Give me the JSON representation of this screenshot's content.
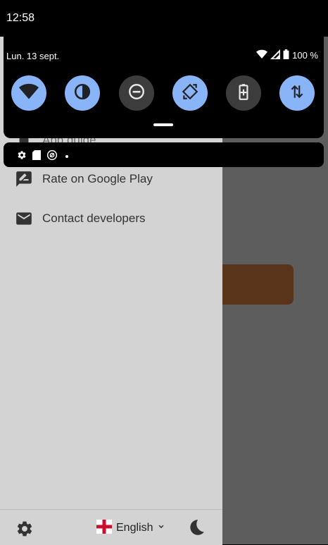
{
  "status_bar": {
    "time": "12:58"
  },
  "quick_settings": {
    "date": "Lun. 13 sept.",
    "battery_pct": "100 %",
    "tiles": [
      {
        "name": "wifi",
        "state": "on"
      },
      {
        "name": "contrast",
        "state": "on"
      },
      {
        "name": "do-not-disturb",
        "state": "off"
      },
      {
        "name": "auto-rotate",
        "state": "on"
      },
      {
        "name": "battery-saver",
        "state": "off"
      },
      {
        "name": "mobile-data",
        "state": "on"
      }
    ]
  },
  "drawer": {
    "items": [
      {
        "label": "App guide",
        "icon": "book-icon"
      },
      {
        "label": "Rate on Google Play",
        "icon": "rate-review-icon"
      },
      {
        "label": "Contact developers",
        "icon": "mail-icon"
      }
    ],
    "footer": {
      "language": "English"
    }
  },
  "colors": {
    "accent": "#8ab4f8",
    "drawer_bg": "#d3d3d3",
    "brown_card": "#5a341a"
  }
}
